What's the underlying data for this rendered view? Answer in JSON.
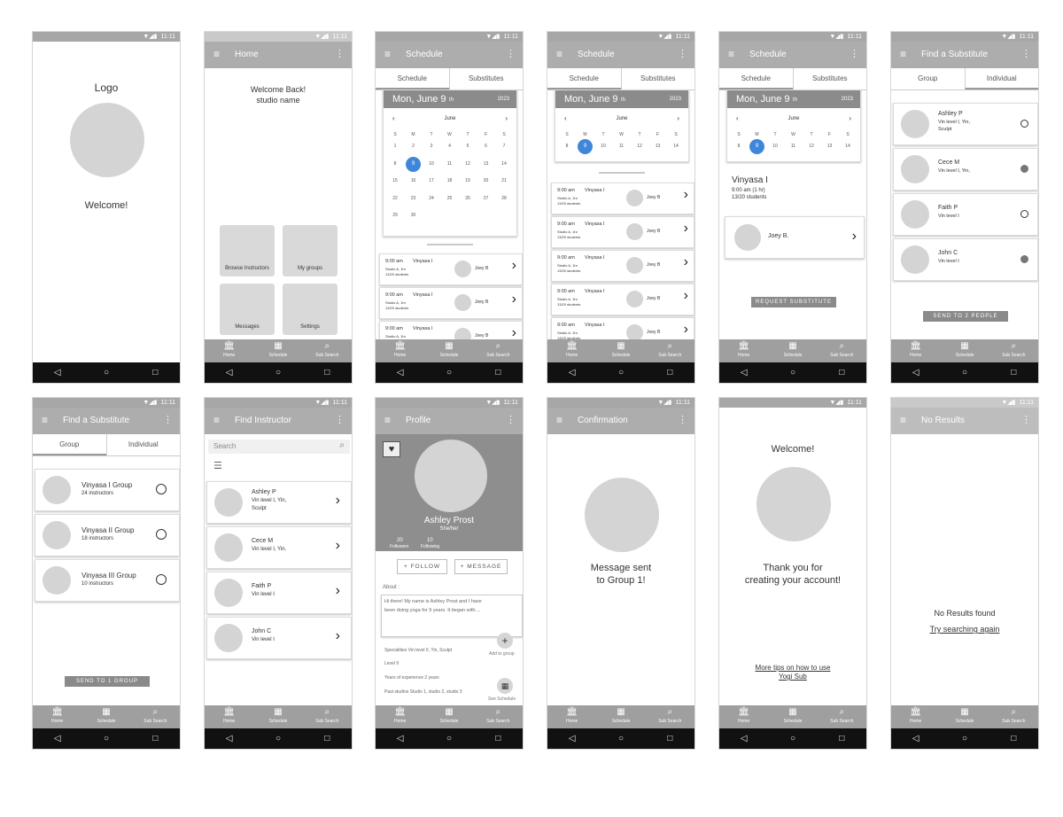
{
  "status": {
    "time": "11:11",
    "icons": "▼◢▮"
  },
  "nav": {
    "home": "Home",
    "schedule": "Schedule",
    "subsearch": "Sub Search"
  },
  "sys": {
    "back": "◁",
    "home": "○",
    "recent": "□"
  },
  "icons": {
    "menu": "≡",
    "more": "⋮",
    "chevron": "›",
    "search": "⌕"
  },
  "login": {
    "logo": "Logo",
    "welcome": "Welcome!"
  },
  "home": {
    "title": "Home",
    "welcome_line1": "Welcome Back!",
    "welcome_line2": "studio name",
    "tiles": [
      "Browse Instructors",
      "My groups",
      "Messages",
      "Settings"
    ]
  },
  "schedule": {
    "title": "Schedule",
    "tab_schedule": "Schedule",
    "tab_substitutes": "Substitutes",
    "date": "Mon, June 9",
    "date_suffix": "th",
    "year": "2023",
    "month": "June",
    "weekdays": [
      "S",
      "M",
      "T",
      "W",
      "T",
      "F",
      "S"
    ],
    "days": [
      "1",
      "2",
      "3",
      "4",
      "5",
      "6",
      "7",
      "8",
      "9",
      "10",
      "11",
      "12",
      "13",
      "14",
      "15",
      "16",
      "17",
      "18",
      "19",
      "20",
      "21",
      "22",
      "23",
      "24",
      "25",
      "26",
      "27",
      "28",
      "29",
      "30"
    ],
    "class_time": "9:00 am",
    "class_name": "Vinyasa I",
    "class_studio": "Studio A, 1hr",
    "class_students": "13/20 students",
    "instructor": "Joey B",
    "detail_title": "Vinyasa I",
    "detail_time": "9:00 am (1 hr)",
    "detail_students": "13/20 students",
    "detail_instructor": "Joey B.",
    "request_btn": "REQUEST SUBSTITUTE"
  },
  "findsub": {
    "title": "Find a Substitute",
    "tab_group": "Group",
    "tab_individual": "Individual",
    "people": [
      {
        "name": "Ashley P",
        "desc1": "Vin level I, Yin,",
        "desc2": "Sculpt"
      },
      {
        "name": "Cece M",
        "desc1": "Vin level I, Yin,",
        "desc2": ""
      },
      {
        "name": "Faith P",
        "desc1": "Vin level I",
        "desc2": ""
      },
      {
        "name": "John C",
        "desc1": "Vin level I",
        "desc2": ""
      }
    ],
    "send_people": "SEND TO 2 PEOPLE",
    "groups": [
      {
        "name": "Vinyasa I Group",
        "count": "24 instructors"
      },
      {
        "name": "Vinyasa II Group",
        "count": "18 instructors"
      },
      {
        "name": "Vinyasa III Group",
        "count": "10 instructors"
      }
    ],
    "send_group": "SEND TO 1 GROUP"
  },
  "findinst": {
    "title": "Find Instructor",
    "search_placeholder": "Search",
    "people": [
      {
        "name": "Ashley P",
        "desc1": "Vin level I, Yin,",
        "desc2": "Sculpt"
      },
      {
        "name": "Cece M",
        "desc1": "Vin level I, Yin.",
        "desc2": ""
      },
      {
        "name": "Faith P",
        "desc1": "Vin level I",
        "desc2": ""
      },
      {
        "name": "John C",
        "desc1": "Vin level I",
        "desc2": ""
      }
    ]
  },
  "profile": {
    "title": "Profile",
    "name": "Ashley Prost",
    "pronouns": "She/her",
    "followers_count": "20",
    "followers_label": "Followers",
    "following_count": "10",
    "following_label": "Following",
    "follow_btn": "+ FOLLOW",
    "message_btn": "+ MESSAGE",
    "about_label": "About :",
    "about_text1": "Hi there!  My name is Ashley Prost and I have",
    "about_text2": "been doing yoga for 9 years.  It began with....",
    "specialties": "Specialities    Vin level II, Yin, Sculpt",
    "level": "Level    II",
    "years": "Years of experience     2 years",
    "past": "Past studios    Studio 1, studio 2, studio 3",
    "add_group": "Add to group",
    "see_schedule": "See Schedule"
  },
  "confirm": {
    "title": "Confirmation",
    "line1": "Message sent",
    "line2": "to Group 1!"
  },
  "welcome": {
    "title": "Welcome!",
    "line1": "Thank you for",
    "line2": "creating your account!",
    "tips1": "More tips on how to use",
    "tips2": "Yogi Sub"
  },
  "noresults": {
    "title": "No Results",
    "line1": "No Results found",
    "line2": "Try searching again"
  }
}
